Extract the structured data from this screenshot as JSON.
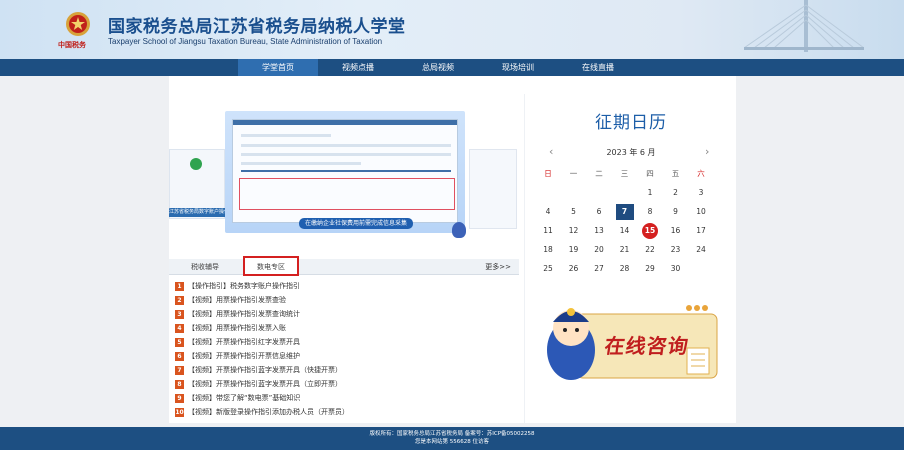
{
  "header": {
    "emblem_label": "中国税务",
    "title": "国家税务总局江苏省税务局纳税人学堂",
    "subtitle": "Taxpayer School of Jiangsu Taxation Bureau, State Administration of Taxation"
  },
  "nav": {
    "items": [
      {
        "label": "学堂首页"
      },
      {
        "label": "视频点播"
      },
      {
        "label": "总局视频"
      },
      {
        "label": "现场培训"
      },
      {
        "label": "在线直播"
      }
    ]
  },
  "banner": {
    "caption": "江苏省税务局数字账户操作指引",
    "tag": "在缴纳企业社保费用前需完成信息采集"
  },
  "tabs": {
    "items": [
      {
        "label": "税收辅导"
      },
      {
        "label": "数电专区"
      }
    ],
    "more": "更多>>"
  },
  "list": [
    {
      "num": "1",
      "text": "【操作指引】税务数字账户操作指引"
    },
    {
      "num": "2",
      "text": "【视频】用票操作指引发票查验"
    },
    {
      "num": "3",
      "text": "【视频】用票操作指引发票查询统计"
    },
    {
      "num": "4",
      "text": "【视频】用票操作指引发票入账"
    },
    {
      "num": "5",
      "text": "【视频】开票操作指引红字发票开具"
    },
    {
      "num": "6",
      "text": "【视频】开票操作指引开票信息维护"
    },
    {
      "num": "7",
      "text": "【视频】开票操作指引蓝字发票开具（快捷开票）"
    },
    {
      "num": "8",
      "text": "【视频】开票操作指引蓝字发票开具（立即开票）"
    },
    {
      "num": "9",
      "text": "【视频】带您了解“数电票”基础知识"
    },
    {
      "num": "10",
      "text": "【视频】新版登录操作指引添加办税人员（开票员）"
    }
  ],
  "calendar": {
    "title": "征期日历",
    "prev": "‹",
    "next": "›",
    "month_label": "2023 年 6 月",
    "weekdays": [
      "日",
      "一",
      "二",
      "三",
      "四",
      "五",
      "六"
    ],
    "weeks": [
      [
        "",
        "",
        "",
        "",
        "1",
        "2",
        "3"
      ],
      [
        "4",
        "5",
        "6",
        "7",
        "8",
        "9",
        "10"
      ],
      [
        "11",
        "12",
        "13",
        "14",
        "15",
        "16",
        "17"
      ],
      [
        "18",
        "19",
        "20",
        "21",
        "22",
        "23",
        "24"
      ],
      [
        "25",
        "26",
        "27",
        "28",
        "29",
        "30",
        ""
      ]
    ],
    "selected_day": "7",
    "today_day": "15",
    "colors": {
      "selected": "#1f4c80",
      "today": "#d42020"
    }
  },
  "consult": {
    "label": "在线咨询"
  },
  "footer": {
    "line1": "版权所有：国家税务总局江苏省税务局 备案号：苏ICP备05002258",
    "line2": "您是本网站第 556628 位访客"
  },
  "colors": {
    "nav_bg": "#1d4f82",
    "nav_active": "#2f6eb0",
    "accent_red": "#d42020",
    "title_blue": "#1a4f8e"
  }
}
